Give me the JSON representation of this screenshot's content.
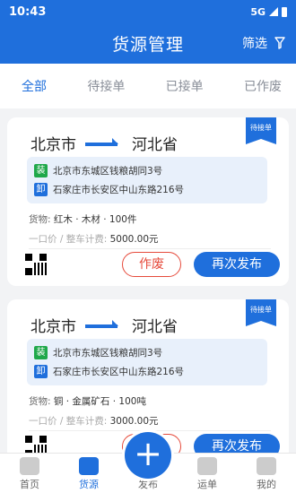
{
  "status": {
    "time": "10:43",
    "network": "5G"
  },
  "header": {
    "title": "货源管理",
    "filter_label": "筛选"
  },
  "tabs": [
    {
      "label": "全部",
      "active": true
    },
    {
      "label": "待接单",
      "active": false
    },
    {
      "label": "已接单",
      "active": false
    },
    {
      "label": "已作废",
      "active": false
    }
  ],
  "cards": [
    {
      "badge": "待接单",
      "from": "北京市",
      "to": "河北省",
      "load_tag": "装",
      "load_addr": "北京市东城区钱粮胡同3号",
      "unload_tag": "卸",
      "unload_addr": "石家庄市长安区中山东路216号",
      "cargo_label": "货物:",
      "cargo": "红木 · 木材 · 100件",
      "price_label": "一口价 / 整车计费:",
      "price": "5000.00元",
      "cancel_label": "作废",
      "repost_label": "再次发布"
    },
    {
      "badge": "待接单",
      "from": "北京市",
      "to": "河北省",
      "load_tag": "装",
      "load_addr": "北京市东城区钱粮胡同3号",
      "unload_tag": "卸",
      "unload_addr": "石家庄市长安区中山东路216号",
      "cargo_label": "货物:",
      "cargo": "铜 · 金属矿石 · 100吨",
      "price_label": "一口价 / 整车计费:",
      "price": "3000.00元",
      "cancel_label": "作废",
      "repost_label": "再次发布"
    }
  ],
  "bottom_nav": [
    {
      "label": "首页",
      "icon": "home-icon"
    },
    {
      "label": "货源",
      "icon": "cargo-icon",
      "active": true
    },
    {
      "label": "发布",
      "icon": "plus-icon"
    },
    {
      "label": "运单",
      "icon": "waybill-icon"
    },
    {
      "label": "我的",
      "icon": "profile-icon"
    }
  ],
  "fab_icon": "+",
  "colors": {
    "primary": "#1f6fdc",
    "danger": "#e64a3b",
    "load_green": "#1fa84a"
  }
}
